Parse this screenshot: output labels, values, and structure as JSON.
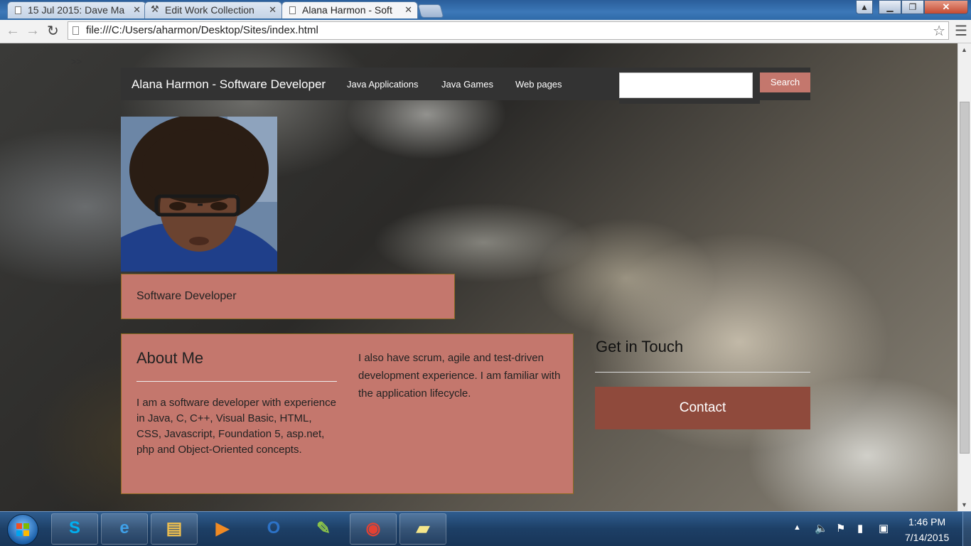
{
  "browser": {
    "tabs": [
      {
        "label": "15 Jul 2015: Dave Ma",
        "active": false,
        "icon": "page-icon"
      },
      {
        "label": "Edit Work Collection",
        "active": false,
        "icon": "tools-icon"
      },
      {
        "label": "Alana Harmon - Soft",
        "active": true,
        "icon": "page-icon"
      }
    ],
    "url": "file:///C:/Users/aharmon/Desktop/Sites/index.html"
  },
  "page": {
    "crumb_arrows": ">>",
    "site_name": "Alana Harmon - Software Developer",
    "nav": [
      "Java Applications",
      "Java Games",
      "Web pages"
    ],
    "search_button": "Search",
    "search_value": "",
    "title": "Software Developer",
    "about": {
      "heading": "About Me",
      "body": "I am a software developer with experience in Java, C, C++, Visual Basic, HTML, CSS, Javascript, Foundation 5, asp.net, php and Object-Oriented concepts.",
      "body2": "I also have scrum, agile and test-driven development experience. I am familiar with the application lifecycle."
    },
    "contact": {
      "heading": "Get in Touch",
      "button": "Contact"
    },
    "colors": {
      "panel": "#c4776d",
      "contact_button": "#8f4a3c",
      "topbar": "#333333"
    }
  },
  "taskbar": {
    "apps": [
      "skype-icon",
      "internet-explorer-icon",
      "file-explorer-icon",
      "media-player-icon",
      "outlook-icon",
      "notepad-plus-icon",
      "chrome-icon",
      "sticky-notes-icon"
    ],
    "time": "1:46 PM",
    "date": "7/14/2015"
  }
}
